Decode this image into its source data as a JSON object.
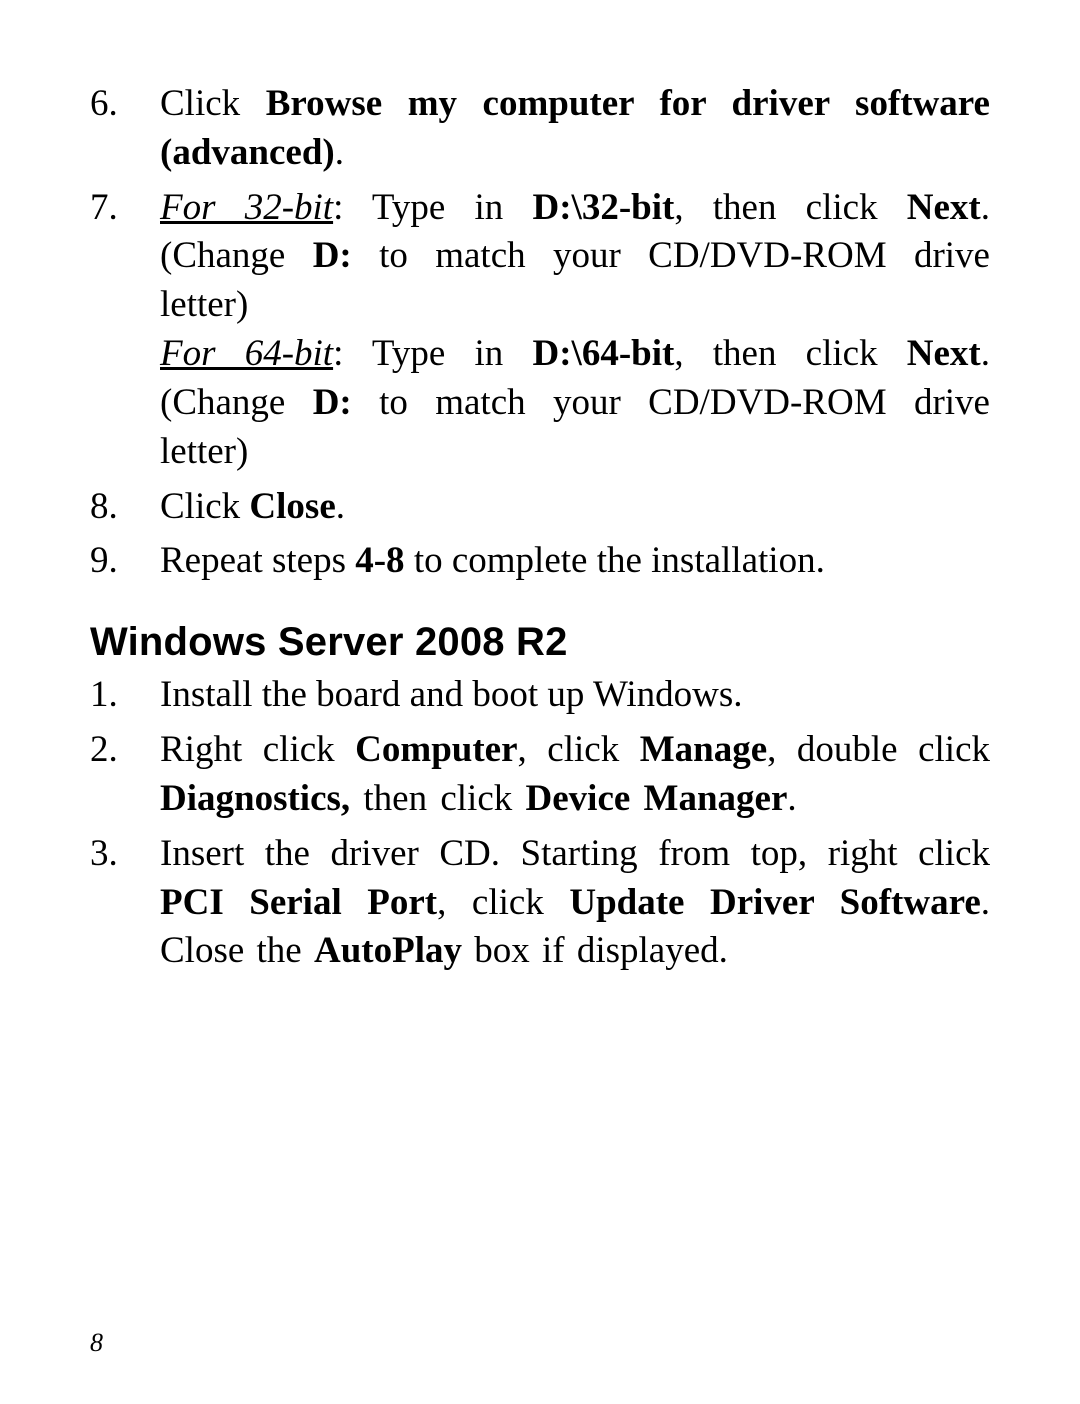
{
  "listA": {
    "items": [
      {
        "num": "6.",
        "pre": "Click ",
        "bold": "Browse my computer for driver software (advanced)",
        "post": "."
      },
      {
        "num": "7.",
        "line1_iu": "For 32-bit",
        "line1_a": ": Type in ",
        "line1_b": "D:\\32-bit",
        "line1_c": ", then click ",
        "line1_d": "Next",
        "line1_e": ". (Change ",
        "line1_f": "D:",
        "line1_g": " to match your CD/DVD-ROM drive letter)",
        "line2_iu": "For 64-bit",
        "line2_a": ": Type in ",
        "line2_b": "D:\\64-bit",
        "line2_c": ", then click ",
        "line2_d": "Next",
        "line2_e": ". (Change ",
        "line2_f": "D:",
        "line2_g": " to match your CD/DVD-ROM drive letter)"
      },
      {
        "num": "8.",
        "pre": "Click ",
        "bold": "Close",
        "post": "."
      },
      {
        "num": "9.",
        "pre": "Repeat steps ",
        "bold": "4-8",
        "post": " to complete the installation."
      }
    ]
  },
  "heading": "Windows Server 2008 R2",
  "listB": {
    "items": [
      {
        "num": "1.",
        "text": "Install the board and boot up Windows."
      },
      {
        "num": "2.",
        "a": "Right click ",
        "b": "Computer",
        "c": ", click ",
        "d": "Manage",
        "e": ", double click ",
        "f": "Diagnostics,",
        "g": " then click ",
        "h": "Device Manager",
        "i": "."
      },
      {
        "num": "3.",
        "a": "Insert the driver CD.  Starting from top, right click ",
        "b": "PCI Serial Port",
        "c": ", click ",
        "d": "Update Driver Software",
        "e": ". Close the ",
        "f": "AutoPlay",
        "g": " box if displayed."
      }
    ]
  },
  "pageNumber": "8"
}
